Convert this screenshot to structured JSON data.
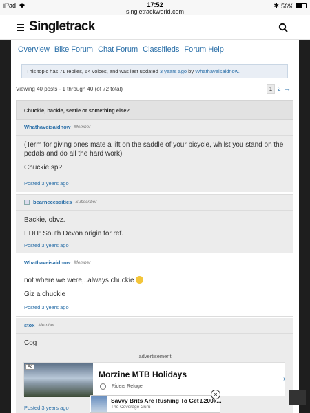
{
  "status_bar": {
    "device": "iPad",
    "time": "17:52",
    "url": "singletrackworld.com",
    "battery": "56%"
  },
  "header": {
    "logo": "Singletrack"
  },
  "subnav": [
    "Overview",
    "Bike Forum",
    "Chat Forum",
    "Classifieds",
    "Forum Help"
  ],
  "topic_info": {
    "text": "This topic has 71 replies, 64 voices, and was last updated ",
    "ago": "3 years ago",
    "by": " by ",
    "user": "Whathaveisaidnow."
  },
  "viewing": "Viewing 40 posts - 1 through 40 (of 72 total)",
  "pagination": {
    "current": "1",
    "next": "2",
    "arrow": "→"
  },
  "topic_title": "Chuckie, backie, seatie or something else?",
  "posts": [
    {
      "author": "Whathaveisaidnow",
      "role": "Member",
      "lines": [
        "(Term for giving ones mate a lift on the saddle of your bicycle, whilst you stand on the pedals and do all the hard work)",
        "Chuckie sp?"
      ],
      "posted": "Posted 3 years ago"
    },
    {
      "author": "bearnecessities",
      "role": "Subscriber",
      "lines": [
        "Backie, obvz.",
        "EDIT: South Devon origin for ref."
      ],
      "posted": "Posted 3 years ago"
    },
    {
      "author": "Whathaveisaidnow",
      "role": "Member",
      "lines": [
        "not where we were,..always chuckie",
        "Giz a chuckie"
      ],
      "posted": "Posted 3 years ago"
    },
    {
      "author": "stox",
      "role": "Member",
      "lines": [
        "Cog"
      ],
      "posted": "Posted 3 years ago"
    }
  ],
  "ad": {
    "label": "advertisement",
    "tag": "Ad",
    "title": "Morzine MTB Holidays",
    "source": "Riders Refuge"
  },
  "banner": {
    "title": "Savvy Brits Are Rushing To Get £200k...",
    "source": "The Coverage Guru",
    "close": "×"
  }
}
